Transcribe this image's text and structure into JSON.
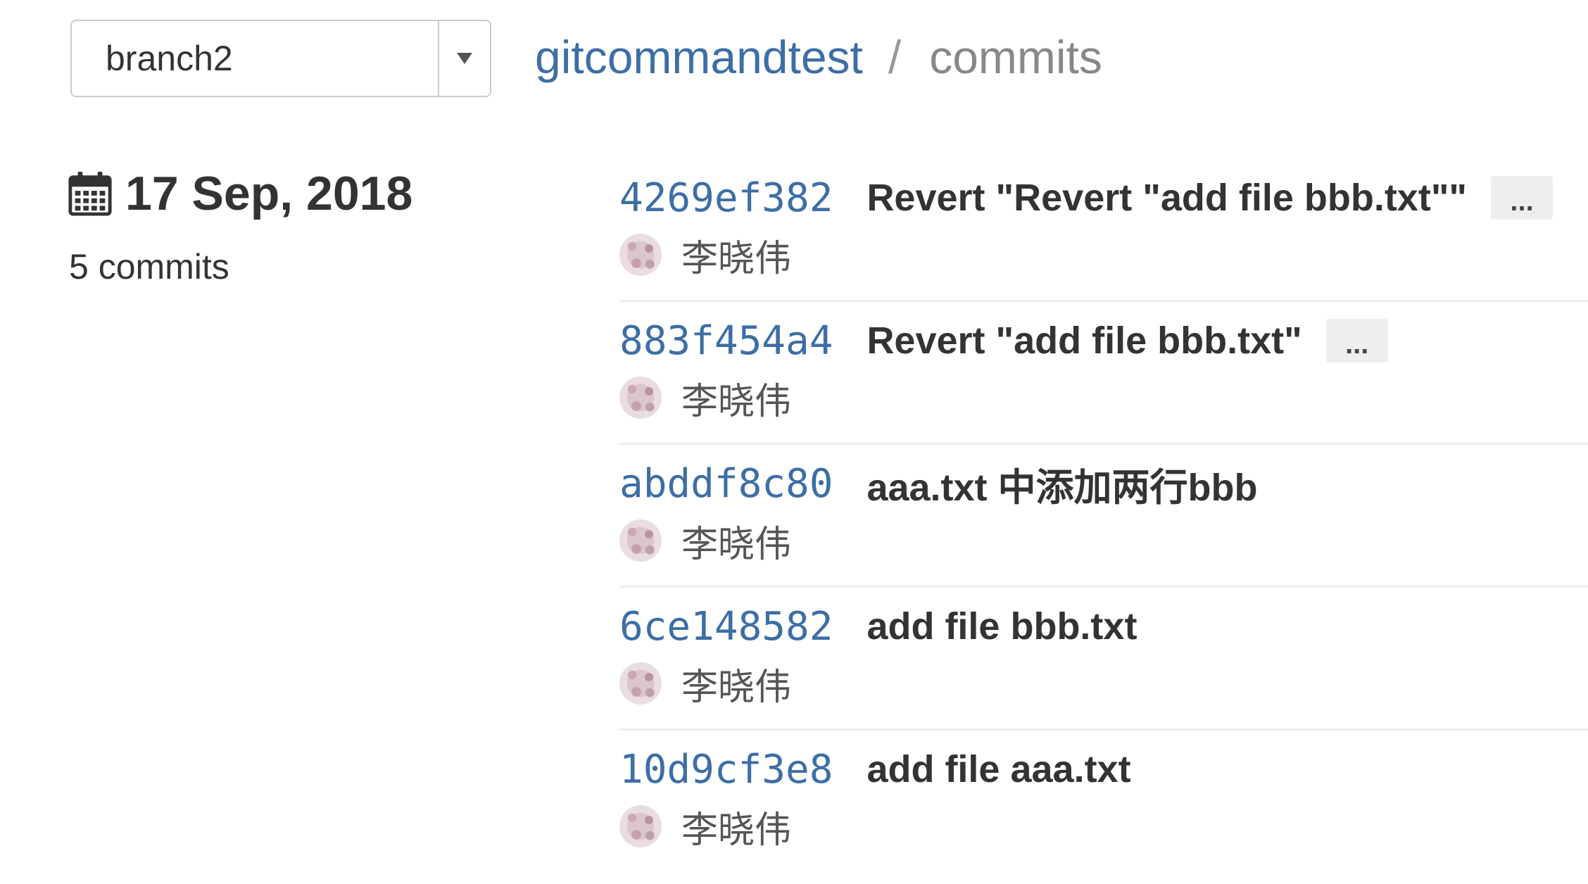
{
  "branch_selector": {
    "value": "branch2"
  },
  "breadcrumb": {
    "project": "gitcommandtest",
    "separator": "/",
    "page": "commits"
  },
  "day_group": {
    "icon": "calendar-icon",
    "date": "17 Sep, 2018",
    "count": "5 commits"
  },
  "commits": [
    {
      "sha": "4269ef382",
      "title": "Revert \"Revert \"add file bbb.txt\"\"",
      "more": "...",
      "author": "李晓伟"
    },
    {
      "sha": "883f454a4",
      "title": "Revert \"add file bbb.txt\"",
      "more": "...",
      "author": "李晓伟"
    },
    {
      "sha": "abddf8c80",
      "title": "aaa.txt 中添加两行bbb",
      "author": "李晓伟"
    },
    {
      "sha": "6ce148582",
      "title": "add file bbb.txt",
      "author": "李晓伟"
    },
    {
      "sha": "10d9cf3e8",
      "title": "add file aaa.txt",
      "author": "李晓伟"
    }
  ],
  "colors": {
    "link": "#3d6ea6",
    "text": "#333333",
    "muted": "#888888",
    "divider": "#eeeeee"
  }
}
